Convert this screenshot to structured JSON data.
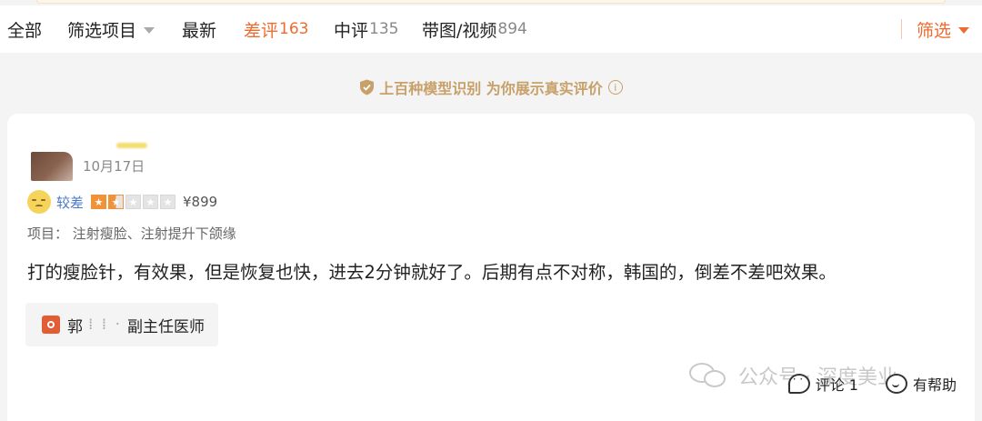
{
  "filter_tabs": [
    {
      "label": "全部",
      "count": ""
    },
    {
      "label": "筛选项目",
      "count": ""
    },
    {
      "label": "最新",
      "count": ""
    },
    {
      "label": "差评",
      "count": "163"
    },
    {
      "label": "中评",
      "count": "135"
    },
    {
      "label": "带图/视频",
      "count": "894"
    }
  ],
  "active_tab_index": 3,
  "filter_button_label": "筛选",
  "accent_color": "#ee6b2f",
  "ai_banner": {
    "text": "上百种模型识别 为你展示真实评价",
    "info_icon": "ⓘ",
    "icon": "shield-check-icon"
  },
  "review": {
    "date": "10月17日",
    "rating_label": "较差",
    "stars": 1.5,
    "stars_max": 5,
    "price": "¥899",
    "project": "项目： 注射瘦脸、注射提升下颌缘",
    "text": "打的瘦脸针，有效果，但是恢复也快，进去2分钟就好了。后期有点不对称，韩国的，倒差不差吧效果。",
    "doctor": {
      "surname": "郭",
      "blurred": "⁞ ⁞ ·",
      "title": "副主任医师"
    }
  },
  "watermark": "公众号 · 深度美业",
  "actions": {
    "comment_label": "评论 1",
    "helpful_label": "有帮助"
  }
}
